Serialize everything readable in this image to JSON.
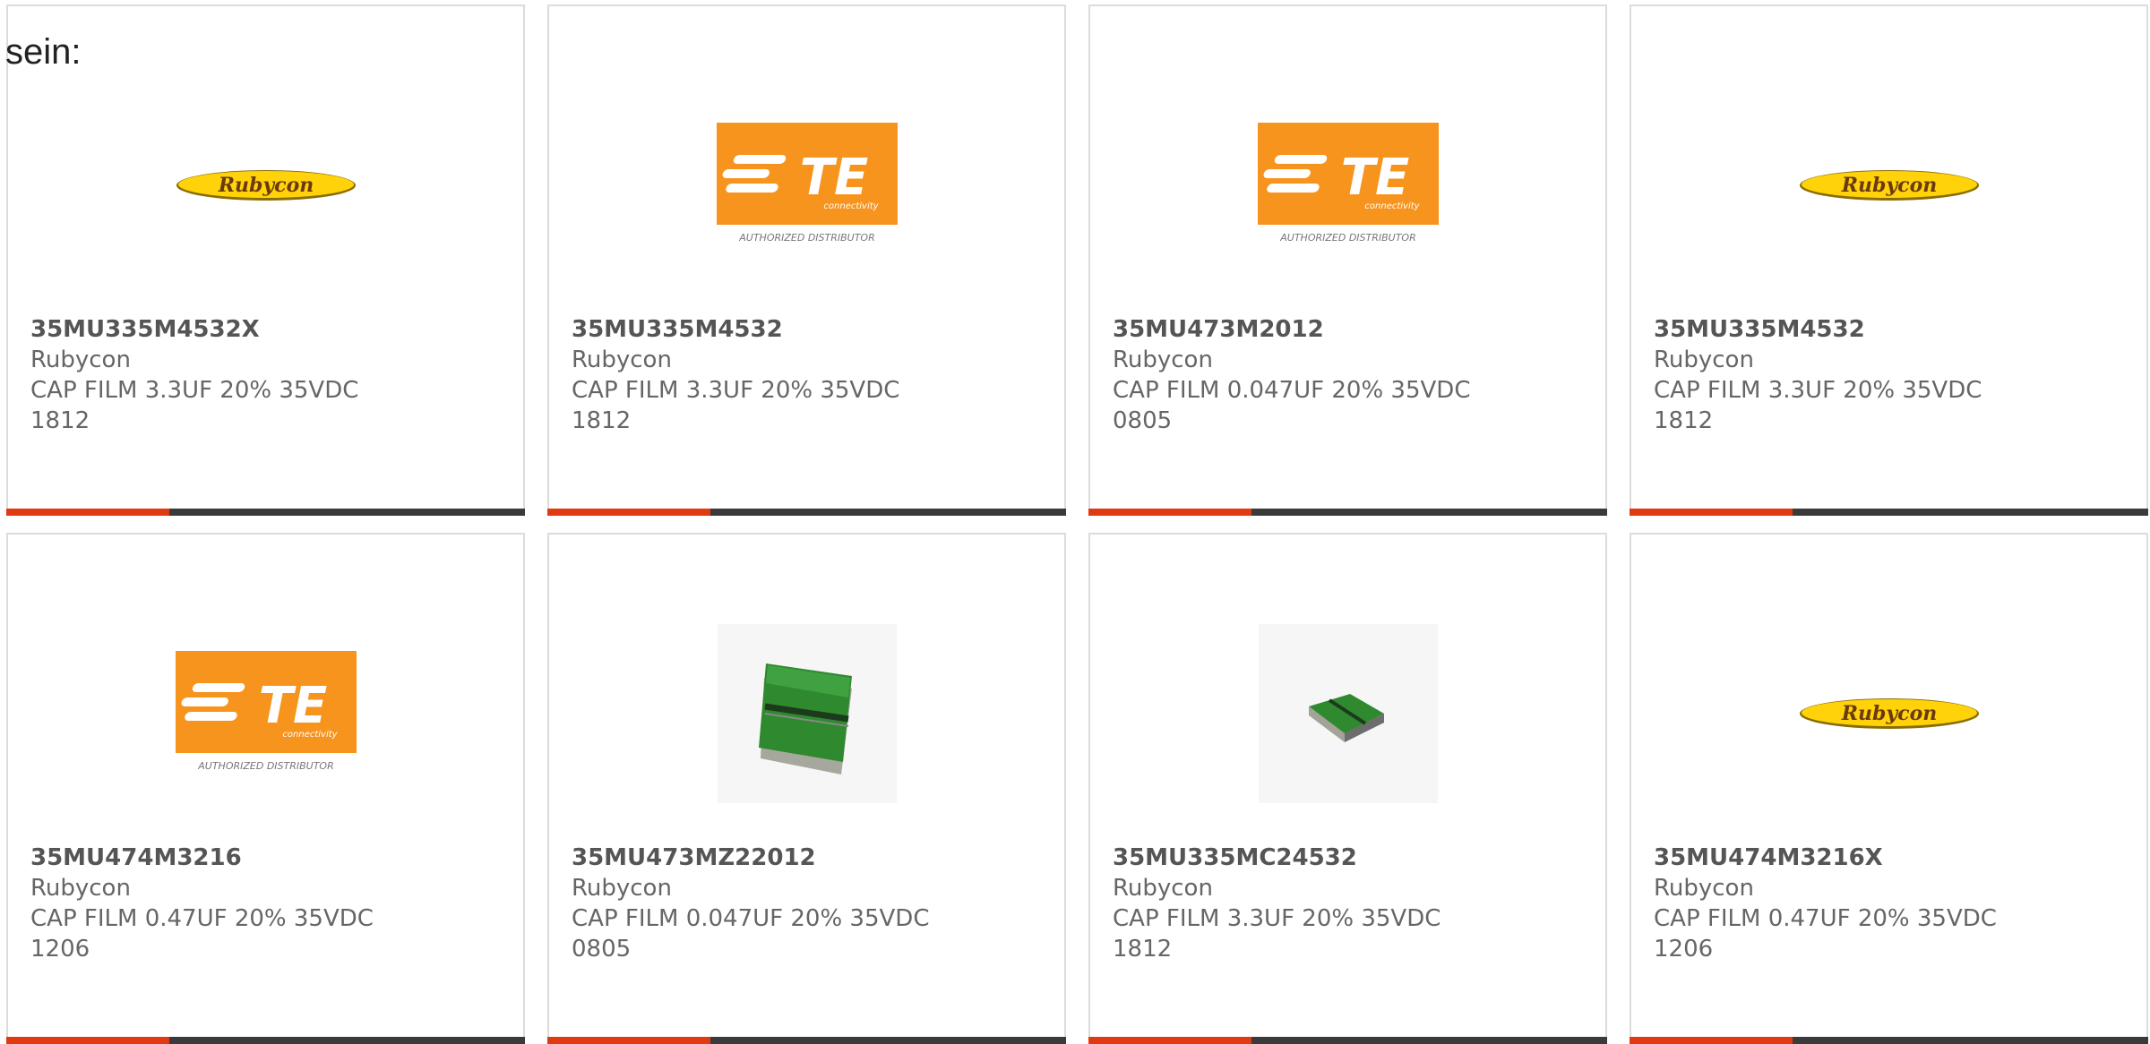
{
  "intro_text": "sein:",
  "colors": {
    "accent_bar": "#e13a12",
    "bar": "#3a3a3a",
    "te_orange": "#f7941d",
    "rubycon_yellow": "#ffd20a"
  },
  "rubycon_logo_text": "Rubycon",
  "te_logo": {
    "mark": "TE",
    "sub": "connectivity",
    "caption": "AUTHORIZED DISTRIBUTOR"
  },
  "products": [
    {
      "image": "rubycon-logo",
      "part_number": "35MU335M4532X",
      "manufacturer": "Rubycon",
      "desc1": "CAP FILM 3.3UF 20% 35VDC",
      "desc2": "1812"
    },
    {
      "image": "te-logo",
      "part_number": "35MU335M4532",
      "manufacturer": "Rubycon",
      "desc1": "CAP FILM 3.3UF 20% 35VDC",
      "desc2": "1812"
    },
    {
      "image": "te-logo",
      "part_number": "35MU473M2012",
      "manufacturer": "Rubycon",
      "desc1": "CAP FILM 0.047UF 20% 35VDC",
      "desc2": "0805"
    },
    {
      "image": "rubycon-logo",
      "part_number": "35MU335M4532",
      "manufacturer": "Rubycon",
      "desc1": "CAP FILM 3.3UF 20% 35VDC",
      "desc2": "1812"
    },
    {
      "image": "te-logo",
      "part_number": "35MU474M3216",
      "manufacturer": "Rubycon",
      "desc1": "CAP FILM 0.47UF 20% 35VDC",
      "desc2": "1206"
    },
    {
      "image": "chip-large",
      "part_number": "35MU473MZ22012",
      "manufacturer": "Rubycon",
      "desc1": "CAP FILM 0.047UF 20% 35VDC",
      "desc2": "0805"
    },
    {
      "image": "chip-small",
      "part_number": "35MU335MC24532",
      "manufacturer": "Rubycon",
      "desc1": "CAP FILM 3.3UF 20% 35VDC",
      "desc2": "1812"
    },
    {
      "image": "rubycon-logo",
      "part_number": "35MU474M3216X",
      "manufacturer": "Rubycon",
      "desc1": "CAP FILM 0.47UF 20% 35VDC",
      "desc2": "1206"
    }
  ]
}
